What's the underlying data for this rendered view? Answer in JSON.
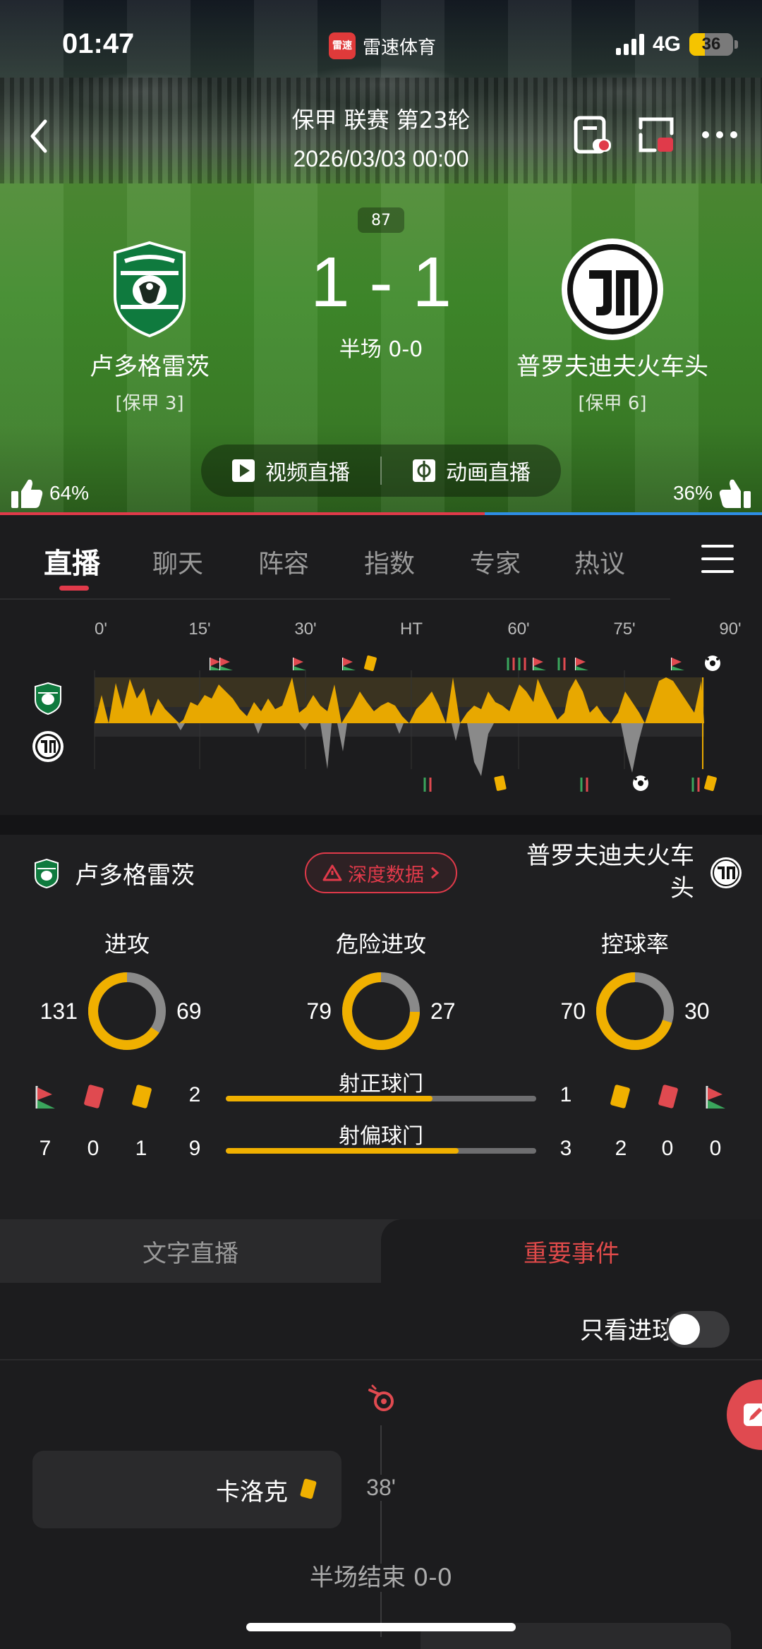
{
  "status_bar": {
    "time": "01:47",
    "app_logo": "雷速",
    "app_name": "雷速体育",
    "network": "4G",
    "battery": "36",
    "battery_level": 0.36
  },
  "match": {
    "league": "保甲 联赛 第23轮",
    "datetime": "2026/03/03 00:00",
    "minute": "87",
    "score": "1 - 1",
    "halftime": "半场 0-0"
  },
  "home": {
    "name": "卢多格雷茨",
    "rank": "[保甲 3]",
    "support": "64%",
    "support_value": 64
  },
  "away": {
    "name": "普罗夫迪夫火车头",
    "rank": "[保甲 6]",
    "support": "36%",
    "support_value": 36
  },
  "live_buttons": {
    "video": "视频直播",
    "animation": "动画直播"
  },
  "tabs": [
    "直播",
    "聊天",
    "阵容",
    "指数",
    "专家",
    "热议"
  ],
  "momentum": {
    "ticks": [
      "0'",
      "15'",
      "30'",
      "HT",
      "60'",
      "75'",
      "90'"
    ]
  },
  "stats": {
    "home_name": "卢多格雷茨",
    "away_name": "普罗夫迪夫火车头",
    "deep_data": "深度数据",
    "donuts": [
      {
        "label": "进攻",
        "home": "131",
        "away": "69",
        "home_value": 131,
        "away_value": 69
      },
      {
        "label": "危险进攻",
        "home": "79",
        "away": "27",
        "home_value": 79,
        "away_value": 27
      },
      {
        "label": "控球率",
        "home": "70",
        "away": "30",
        "home_value": 70,
        "away_value": 30
      }
    ],
    "home_counts": {
      "corners": "7",
      "red": "0",
      "yellow": "1"
    },
    "away_counts": {
      "yellow": "2",
      "red": "0",
      "corners": "0"
    },
    "shots_on": {
      "label": "射正球门",
      "home": "2",
      "away": "1",
      "home_value": 2,
      "away_value": 1
    },
    "shots_off": {
      "label": "射偏球门",
      "home": "9",
      "away": "3",
      "home_value": 9,
      "away_value": 3
    }
  },
  "subtabs": {
    "text_live": "文字直播",
    "key_events": "重要事件"
  },
  "filter": {
    "goals_only": "只看进球"
  },
  "events": {
    "card_player": "卡洛克",
    "card_minute": "38'",
    "halftime": "半场结束 0-0"
  },
  "colors": {
    "home": "#e03a4a",
    "away": "#2e8ee6",
    "accent": "#f0b000",
    "brand": "#e03a3a"
  }
}
